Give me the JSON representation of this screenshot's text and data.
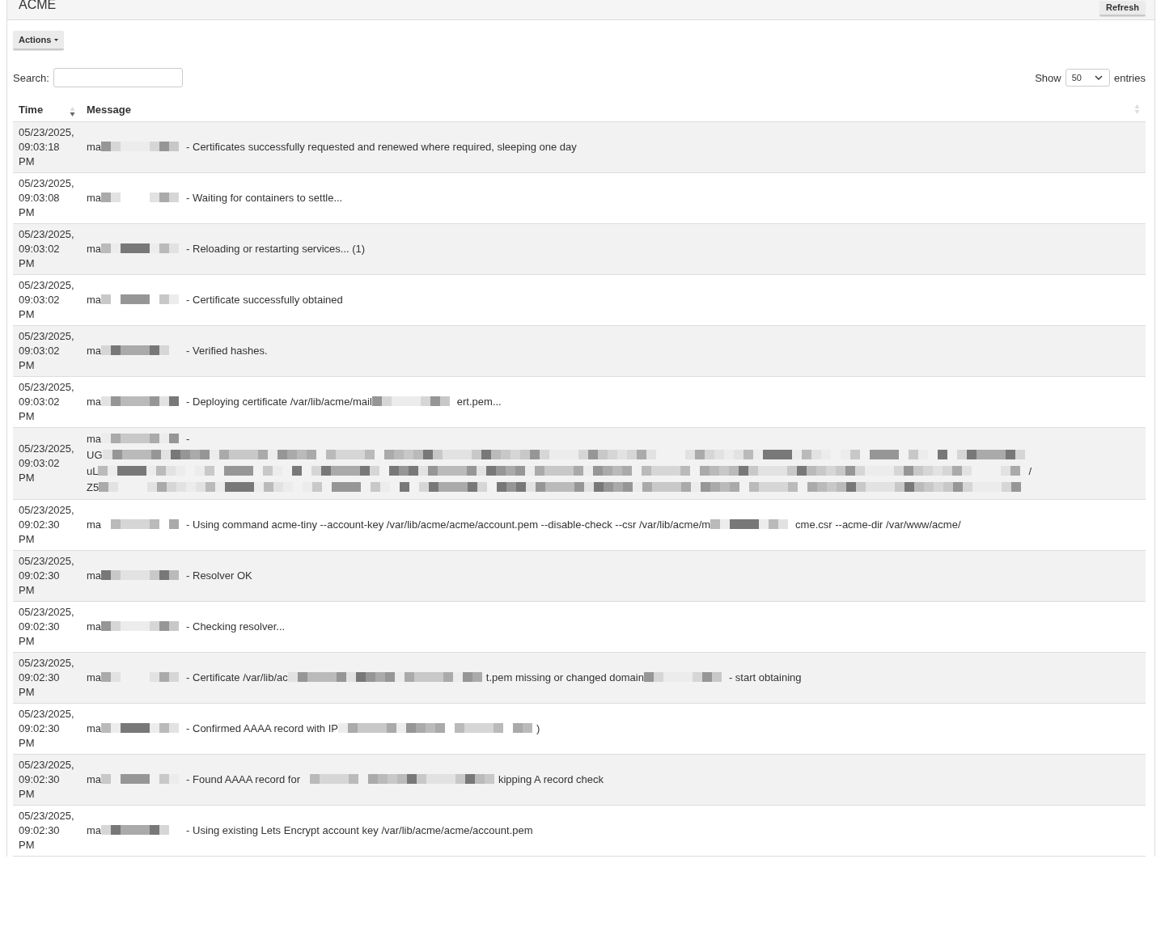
{
  "header": {
    "title": "ACME",
    "refresh_button": "Refresh"
  },
  "actions_button": "Actions",
  "search": {
    "label": "Search:"
  },
  "page_size": {
    "before": "Show",
    "value": "50",
    "after": "entries"
  },
  "table": {
    "columns": [
      {
        "label": "Time",
        "sorted_descending": true
      },
      {
        "label": "Message",
        "sorted_descending": false
      }
    ],
    "rows": [
      {
        "time": "05/23/2025, 09:03:18 PM",
        "message": [
          {
            "kind": "text",
            "text": "ma"
          },
          {
            "kind": "redacted"
          },
          {
            "kind": "text",
            "text": "- Certificates successfully requested and renewed where required, sleeping one day"
          }
        ]
      },
      {
        "time": "05/23/2025, 09:03:08 PM",
        "message": [
          {
            "kind": "text",
            "text": "ma"
          },
          {
            "kind": "redacted"
          },
          {
            "kind": "text",
            "text": "- Waiting for containers to settle..."
          }
        ]
      },
      {
        "time": "05/23/2025, 09:03:02 PM",
        "message": [
          {
            "kind": "text",
            "text": "ma"
          },
          {
            "kind": "redacted"
          },
          {
            "kind": "text",
            "text": "- Reloading or restarting services... (1)"
          }
        ]
      },
      {
        "time": "05/23/2025, 09:03:02 PM",
        "message": [
          {
            "kind": "text",
            "text": "ma"
          },
          {
            "kind": "redacted"
          },
          {
            "kind": "text",
            "text": "- Certificate successfully obtained"
          }
        ]
      },
      {
        "time": "05/23/2025, 09:03:02 PM",
        "message": [
          {
            "kind": "text",
            "text": "ma"
          },
          {
            "kind": "redacted"
          },
          {
            "kind": "text",
            "text": "- Verified hashes."
          }
        ]
      },
      {
        "time": "05/23/2025, 09:03:02 PM",
        "message": [
          {
            "kind": "text",
            "text": "ma"
          },
          {
            "kind": "redacted"
          },
          {
            "kind": "text",
            "text": "- Deploying certificate /var/lib/acme/mail"
          },
          {
            "kind": "redacted"
          },
          {
            "kind": "text",
            "text": "ert.pem..."
          }
        ]
      },
      {
        "time": "05/23/2025, 09:03:02 PM",
        "message": [
          {
            "kind": "text",
            "text": "ma"
          },
          {
            "kind": "redacted"
          },
          {
            "kind": "text",
            "text": "-"
          },
          {
            "kind": "break"
          },
          {
            "kind": "text",
            "text": "UG"
          },
          {
            "kind": "redacted-line"
          },
          {
            "kind": "break"
          },
          {
            "kind": "text",
            "text": "uL"
          },
          {
            "kind": "redacted-line"
          },
          {
            "kind": "text",
            "text": "/"
          },
          {
            "kind": "break"
          },
          {
            "kind": "text",
            "text": "Z5"
          },
          {
            "kind": "redacted-line"
          }
        ]
      },
      {
        "time": "05/23/2025, 09:02:30 PM",
        "message": [
          {
            "kind": "text",
            "text": "ma"
          },
          {
            "kind": "redacted"
          },
          {
            "kind": "text",
            "text": "- Using command acme-tiny --account-key /var/lib/acme/acme/account.pem --disable-check --csr /var/lib/acme/m"
          },
          {
            "kind": "redacted"
          },
          {
            "kind": "text",
            "text": "cme.csr --acme-dir /var/www/acme/"
          }
        ]
      },
      {
        "time": "05/23/2025, 09:02:30 PM",
        "message": [
          {
            "kind": "text",
            "text": "ma"
          },
          {
            "kind": "redacted"
          },
          {
            "kind": "text",
            "text": "- Resolver OK"
          }
        ]
      },
      {
        "time": "05/23/2025, 09:02:30 PM",
        "message": [
          {
            "kind": "text",
            "text": "ma"
          },
          {
            "kind": "redacted"
          },
          {
            "kind": "text",
            "text": "- Checking resolver..."
          }
        ]
      },
      {
        "time": "05/23/2025, 09:02:30 PM",
        "message": [
          {
            "kind": "text",
            "text": "ma"
          },
          {
            "kind": "redacted"
          },
          {
            "kind": "text",
            "text": "- Certificate /var/lib/ac"
          },
          {
            "kind": "redacted-wide"
          },
          {
            "kind": "text",
            "text": "t.pem missing or changed domain"
          },
          {
            "kind": "redacted"
          },
          {
            "kind": "text",
            "text": "- start obtaining"
          }
        ]
      },
      {
        "time": "05/23/2025, 09:02:30 PM",
        "message": [
          {
            "kind": "text",
            "text": "ma"
          },
          {
            "kind": "redacted"
          },
          {
            "kind": "text",
            "text": "- Confirmed AAAA record with IP"
          },
          {
            "kind": "redacted-wide"
          },
          {
            "kind": "text",
            "text": ")"
          }
        ]
      },
      {
        "time": "05/23/2025, 09:02:30 PM",
        "message": [
          {
            "kind": "text",
            "text": "ma"
          },
          {
            "kind": "redacted"
          },
          {
            "kind": "text",
            "text": "- Found AAAA record for"
          },
          {
            "kind": "redacted-wide"
          },
          {
            "kind": "text",
            "text": "kipping A record check"
          }
        ]
      },
      {
        "time": "05/23/2025, 09:02:30 PM",
        "message": [
          {
            "kind": "text",
            "text": "ma"
          },
          {
            "kind": "redacted"
          },
          {
            "kind": "text",
            "text": "- Using existing Lets Encrypt account key /var/lib/acme/acme/account.pem"
          }
        ]
      }
    ]
  }
}
